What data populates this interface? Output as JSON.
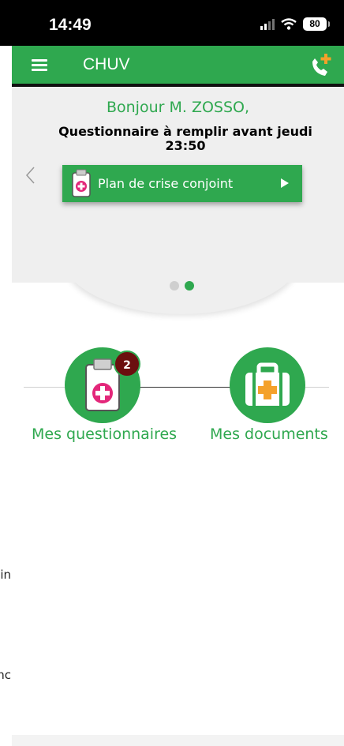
{
  "status_bar": {
    "time": "14:49",
    "battery": "80"
  },
  "app_bar": {
    "title": "CHUV"
  },
  "banner": {
    "greeting": "Bonjour M. ZOSSO,",
    "reminder": "Questionnaire à remplir avant jeudi 23:50",
    "card_label": "Plan de crise conjoint",
    "page_count": 2,
    "active_page": 2
  },
  "shortcuts": {
    "questionnaires": {
      "label": "Mes questionnaires",
      "badge": "2"
    },
    "documents": {
      "label": "Mes documents"
    }
  },
  "sidebar_peek": {
    "item_1": "in",
    "item_2": "nc"
  },
  "colors": {
    "primary": "#2fa84f",
    "badge": "#6b0f0f",
    "accent_plus": "#f4a12a",
    "icon_pink": "#e3277a"
  },
  "icons": [
    "menu-icon",
    "phone-plus-icon",
    "chevron-left-icon",
    "clipboard-plus-icon",
    "play-icon",
    "medical-kit-icon"
  ]
}
